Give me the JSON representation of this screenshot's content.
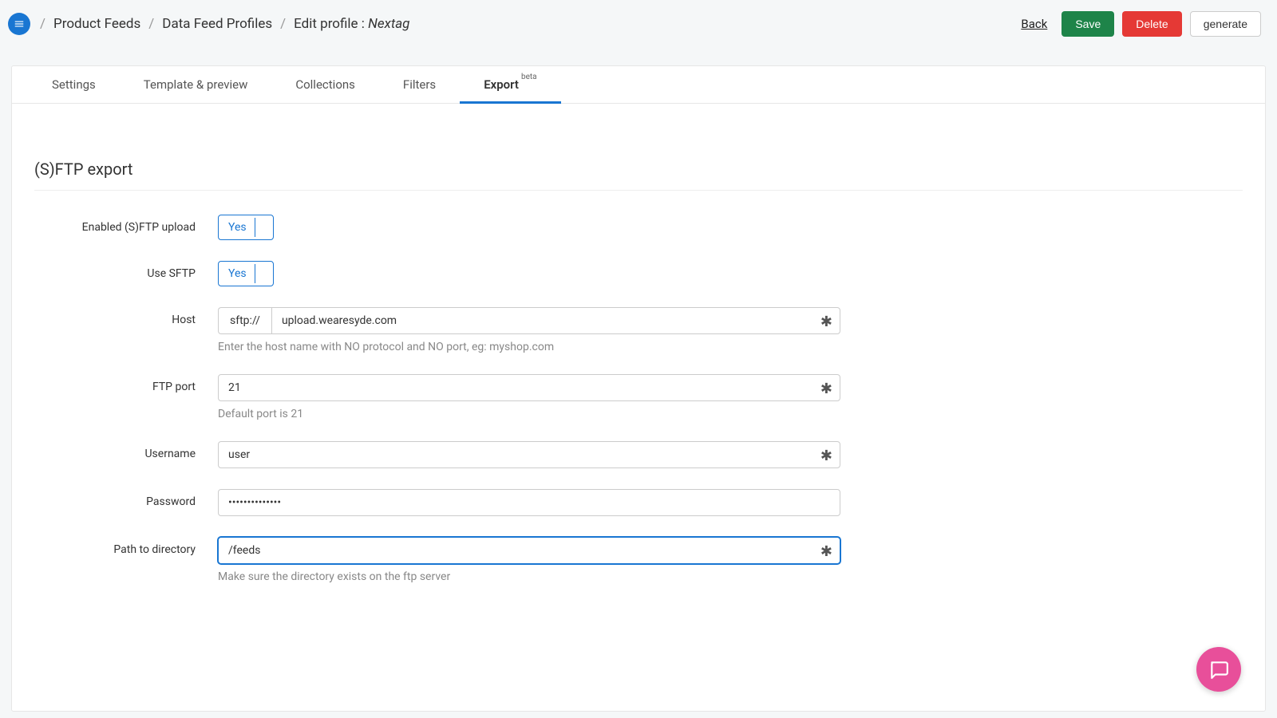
{
  "topbar": {
    "breadcrumb": [
      "Product Feeds",
      "Data Feed Profiles"
    ],
    "edit_label": "Edit profile :",
    "profile_name": "Nextag",
    "back": "Back",
    "save": "Save",
    "delete": "Delete",
    "generate": "generate"
  },
  "tabs": {
    "settings": "Settings",
    "template": "Template & preview",
    "collections": "Collections",
    "filters": "Filters",
    "export": "Export",
    "export_badge": "beta"
  },
  "section": {
    "title": "(S)FTP export"
  },
  "form": {
    "enabled_label": "Enabled (S)FTP upload",
    "enabled_value": "Yes",
    "sftp_label": "Use SFTP",
    "sftp_value": "Yes",
    "host_label": "Host",
    "host_prefix": "sftp://",
    "host_value": "upload.wearesyde.com",
    "host_help": "Enter the host name with NO protocol and NO port, eg: myshop.com",
    "port_label": "FTP port",
    "port_value": "21",
    "port_help": "Default port is 21",
    "username_label": "Username",
    "username_value": "user",
    "password_label": "Password",
    "password_value": "••••••••••••••",
    "path_label": "Path to directory",
    "path_value": "/feeds",
    "path_help": "Make sure the directory exists on the ftp server"
  }
}
